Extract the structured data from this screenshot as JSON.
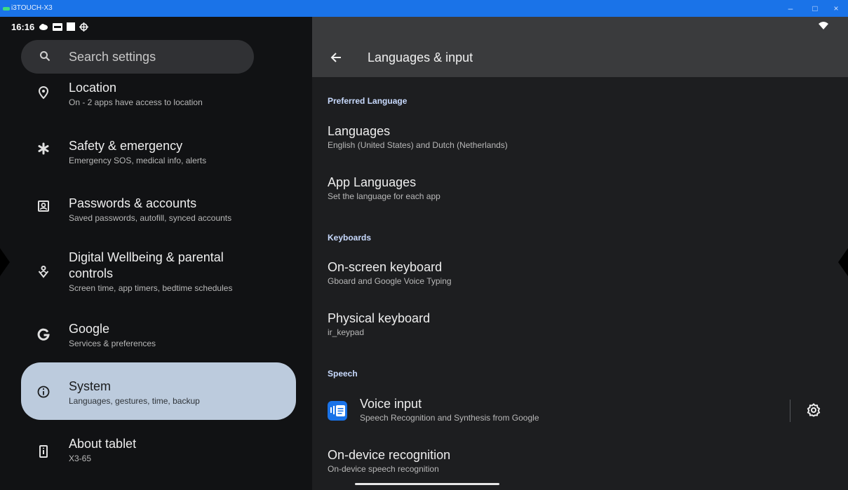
{
  "window": {
    "title": "i3TOUCH-X3",
    "controls": [
      "–",
      "□",
      "×"
    ]
  },
  "status": {
    "time": "16:16"
  },
  "search": {
    "placeholder": "Search settings"
  },
  "left_items": [
    {
      "title": "Location",
      "subtitle": "On - 2 apps have access to location",
      "icon": "location-pin-icon"
    },
    {
      "title": "Safety & emergency",
      "subtitle": "Emergency SOS, medical info, alerts",
      "icon": "asterisk-icon"
    },
    {
      "title": "Passwords & accounts",
      "subtitle": "Saved passwords, autofill, synced accounts",
      "icon": "account-box-icon"
    },
    {
      "title_line1": "Digital Wellbeing & parental",
      "title_line2": "controls",
      "subtitle": "Screen time, app timers, bedtime schedules",
      "icon": "wellbeing-icon"
    },
    {
      "title": "Google",
      "subtitle": "Services & preferences",
      "icon": "google-g-icon"
    },
    {
      "title": "System",
      "subtitle": "Languages, gestures, time, backup",
      "icon": "info-icon",
      "selected": true
    },
    {
      "title": "About tablet",
      "subtitle": "X3-65",
      "icon": "tablet-icon"
    }
  ],
  "right": {
    "title": "Languages & input",
    "sections": {
      "preferred": "Preferred Language",
      "keyboards": "Keyboards",
      "speech": "Speech"
    },
    "items": {
      "languages": {
        "title": "Languages",
        "subtitle": "English (United States) and Dutch (Netherlands)"
      },
      "app_languages": {
        "title": "App Languages",
        "subtitle": "Set the language for each app"
      },
      "onscreen": {
        "title": "On-screen keyboard",
        "subtitle": "Gboard and Google Voice Typing"
      },
      "physical": {
        "title": "Physical keyboard",
        "subtitle": "ir_keypad"
      },
      "voice": {
        "title": "Voice input",
        "subtitle": "Speech Recognition and Synthesis from Google"
      },
      "ondevice": {
        "title": "On-device recognition",
        "subtitle": "On-device speech recognition"
      }
    }
  },
  "colors": {
    "titlebar": "#1a73e8",
    "left_bg": "#111214",
    "right_bg": "#1d1e20",
    "header_bg": "#3a3b3d",
    "selected_bg": "#bccbdd",
    "section_text": "#c9dbff"
  }
}
